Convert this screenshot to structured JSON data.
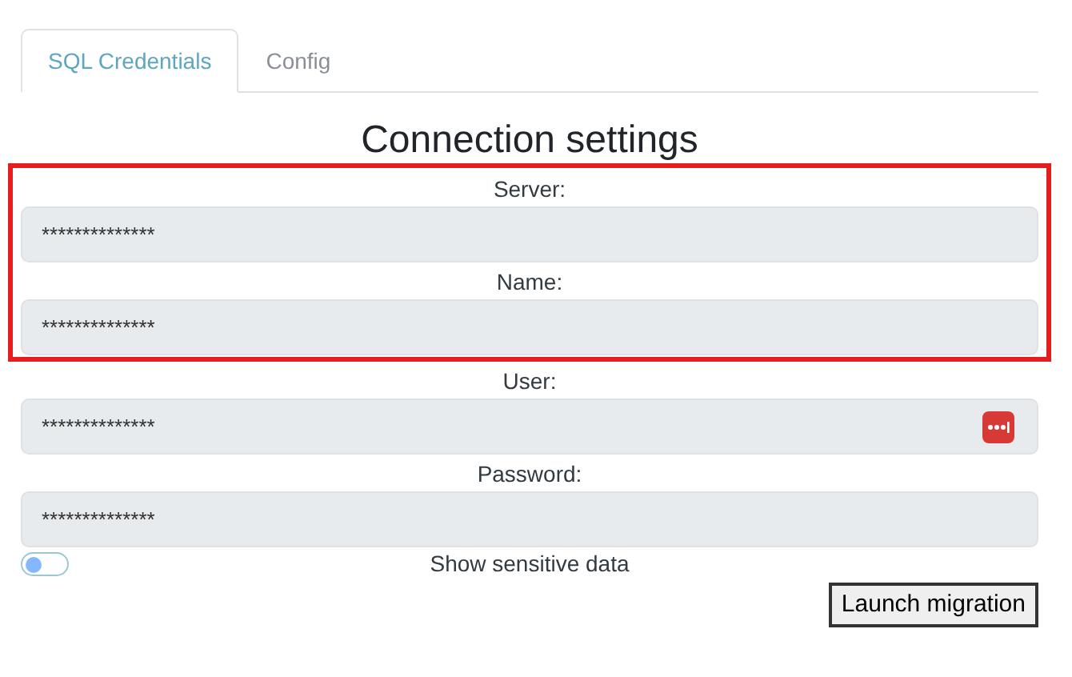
{
  "tabs": [
    {
      "label": "SQL Credentials",
      "selected": true
    },
    {
      "label": "Config",
      "selected": false
    }
  ],
  "heading": "Connection settings",
  "fields": [
    {
      "label": "Server:",
      "value": "**************",
      "highlighted": true,
      "manager_badge": false
    },
    {
      "label": "Name:",
      "value": "**************",
      "highlighted": true,
      "manager_badge": false
    },
    {
      "label": "User:",
      "value": "**************",
      "highlighted": false,
      "manager_badge": true
    },
    {
      "label": "Password:",
      "value": "**************",
      "highlighted": false,
      "manager_badge": false
    }
  ],
  "sensitive_toggle": {
    "label": "Show sensitive data",
    "on": false
  },
  "launch_button": "Launch migration"
}
